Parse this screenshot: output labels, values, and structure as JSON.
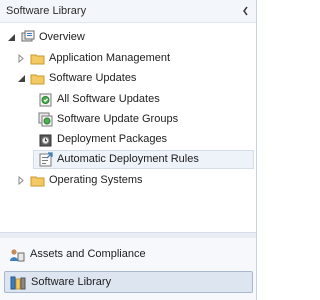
{
  "pane": {
    "title": "Software Library",
    "collapse_icon": "chevron-left-icon"
  },
  "tree": {
    "root": {
      "label": "Overview",
      "icon": "overview-icon",
      "expanded": true
    },
    "app_mgmt": {
      "label": "Application Management",
      "icon": "folder-icon",
      "expanded": false
    },
    "sw_updates": {
      "label": "Software Updates",
      "icon": "folder-icon",
      "expanded": true
    },
    "all_updates": {
      "label": "All Software Updates",
      "icon": "software-update-icon"
    },
    "update_groups": {
      "label": "Software Update Groups",
      "icon": "update-group-icon"
    },
    "deploy_pkgs": {
      "label": "Deployment Packages",
      "icon": "deployment-package-icon"
    },
    "adr": {
      "label": "Automatic Deployment Rules",
      "icon": "deployment-rule-icon",
      "selected": true
    },
    "os": {
      "label": "Operating Systems",
      "icon": "folder-icon",
      "expanded": false
    }
  },
  "workspaces": [
    {
      "label": "Assets and Compliance",
      "icon": "assets-compliance-icon",
      "active": false
    },
    {
      "label": "Software Library",
      "icon": "software-library-icon",
      "active": true
    }
  ],
  "colors": {
    "folder": "#f2c963",
    "selection": "#eef3fa",
    "accent": "#3c7fc1"
  }
}
